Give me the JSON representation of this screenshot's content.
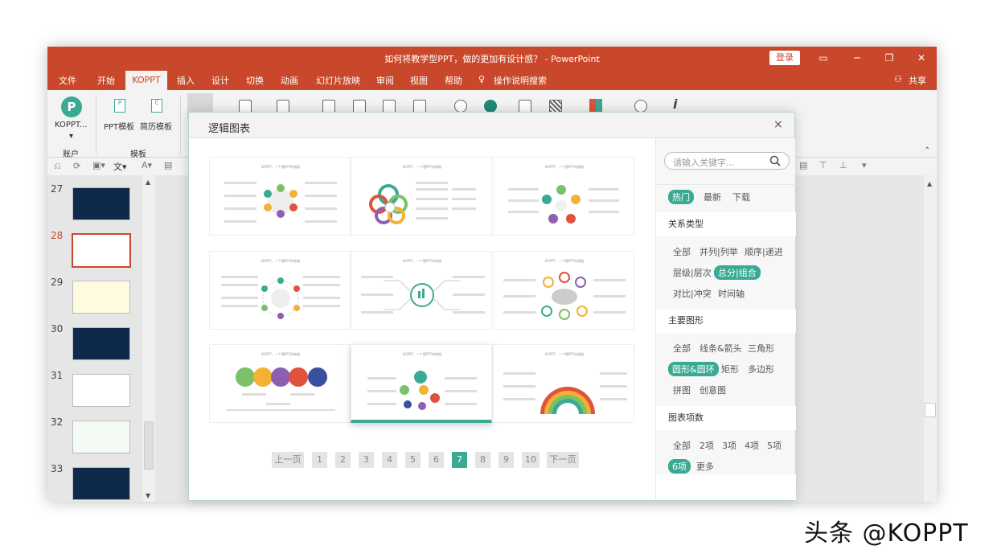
{
  "window": {
    "title": "如何将教学型PPT，做的更加有设计感？ - PowerPoint",
    "login_label": "登录",
    "share_label": "共享"
  },
  "tabs": [
    "文件",
    "开始",
    "KOPPT",
    "插入",
    "设计",
    "切换",
    "动画",
    "幻灯片放映",
    "审阅",
    "视图",
    "帮助"
  ],
  "tell_me": "操作说明搜索",
  "ribbon": {
    "koppt_btn": "KOPPT...",
    "ppt_template": "PPT模板",
    "resume_template": "简历模板",
    "group_account": "账户",
    "group_template": "模板"
  },
  "slides": [
    {
      "num": "27",
      "style": "dark"
    },
    {
      "num": "28",
      "style": "selected"
    },
    {
      "num": "29",
      "style": "light"
    },
    {
      "num": "30",
      "style": "dark"
    },
    {
      "num": "31",
      "style": "light"
    },
    {
      "num": "32",
      "style": "light"
    },
    {
      "num": "33",
      "style": "dark"
    }
  ],
  "dialog": {
    "title": "逻辑图表",
    "close": "×",
    "card_header": "KOPPT，一个懂PPT的神器",
    "prev": "上一页",
    "next": "下一页",
    "pages": [
      "1",
      "2",
      "3",
      "4",
      "5",
      "6",
      "7",
      "8",
      "9",
      "10"
    ],
    "active_page": "7"
  },
  "sidebar": {
    "search_placeholder": "请输入关键字...",
    "sort": [
      {
        "label": "热门",
        "selected": true
      },
      {
        "label": "最新"
      },
      {
        "label": "下载"
      }
    ],
    "relation_header": "关系类型",
    "relation": [
      "全部",
      "并列|列举",
      "顺序|递进",
      "层级|层次",
      "总分|组合",
      "对比|冲突",
      "时间轴"
    ],
    "relation_selected": "总分|组合",
    "shape_header": "主要图形",
    "shapes": [
      "全部",
      "线条&箭头",
      "三角形",
      "圆形&圆环",
      "矩形",
      "多边形",
      "拼图",
      "创意图"
    ],
    "shape_selected": "圆形&圆环",
    "count_header": "图表项数",
    "counts": [
      "全部",
      "2项",
      "3项",
      "4项",
      "5项",
      "6项",
      "更多"
    ],
    "count_selected": "6项"
  },
  "watermark": "头条 @KOPPT",
  "colors": {
    "accent": "#3aaa94",
    "brand": "#c9482b"
  }
}
